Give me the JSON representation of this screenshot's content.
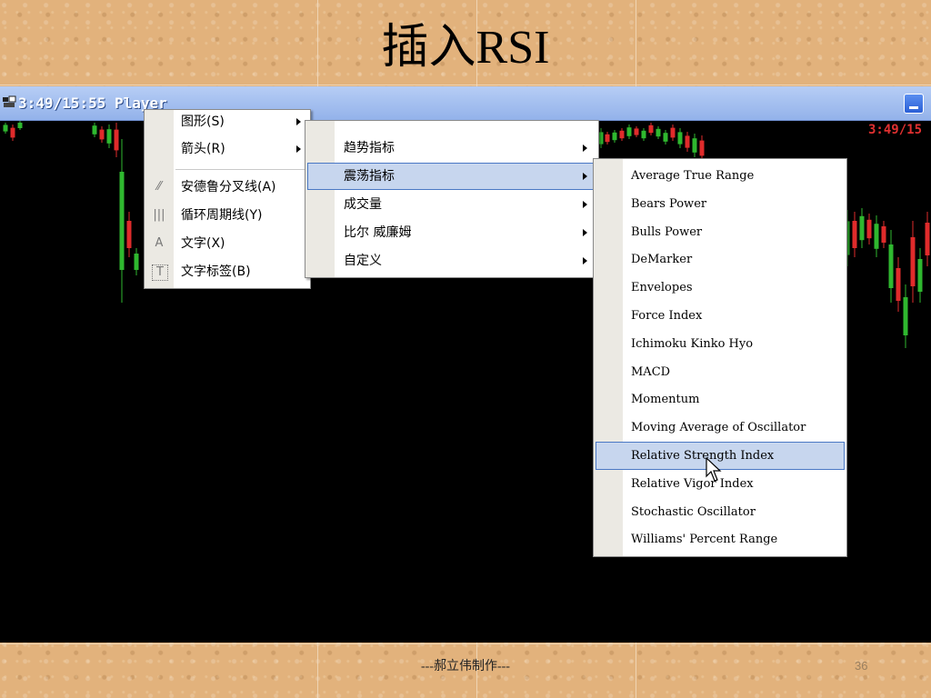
{
  "slide": {
    "title": "插入RSI",
    "footer": "---郝立伟制作---",
    "page_number": "36"
  },
  "window": {
    "title": "3:49/15:55 Player",
    "chart_price_label": "3:49/15",
    "colors": {
      "bull": "#2fb82f",
      "bear": "#e02b2b"
    }
  },
  "menus": {
    "level1": {
      "items": [
        {
          "label": "图形(S)",
          "icon": "",
          "has_submenu": true
        },
        {
          "label": "箭头(R)",
          "icon": "",
          "has_submenu": true
        },
        {
          "label": "安德鲁分叉线(A)",
          "icon": "pitchfork-icon",
          "has_submenu": false
        },
        {
          "label": "循环周期线(Y)",
          "icon": "cycle-lines-icon",
          "has_submenu": false
        },
        {
          "label": "文字(X)",
          "icon": "text-icon",
          "has_submenu": false
        },
        {
          "label": "文字标签(B)",
          "icon": "text-label-icon",
          "has_submenu": false
        }
      ]
    },
    "level2": {
      "items": [
        {
          "label": "趋势指标",
          "highlighted": false
        },
        {
          "label": "震荡指标",
          "highlighted": true
        },
        {
          "label": "成交量",
          "highlighted": false
        },
        {
          "label": "比尔 威廉姆",
          "highlighted": false
        },
        {
          "label": "自定义",
          "highlighted": false
        }
      ]
    },
    "level3": {
      "items": [
        {
          "label": "Average True Range"
        },
        {
          "label": "Bears Power"
        },
        {
          "label": "Bulls Power"
        },
        {
          "label": "DeMarker"
        },
        {
          "label": "Envelopes"
        },
        {
          "label": "Force Index"
        },
        {
          "label": "Ichimoku Kinko Hyo"
        },
        {
          "label": "MACD"
        },
        {
          "label": "Momentum"
        },
        {
          "label": "Moving Average of Oscillator"
        },
        {
          "label": "Relative Strength Index",
          "highlighted": true
        },
        {
          "label": "Relative Vigor Index"
        },
        {
          "label": "Stochastic Oscillator"
        },
        {
          "label": "Williams' Percent Range"
        }
      ]
    }
  }
}
